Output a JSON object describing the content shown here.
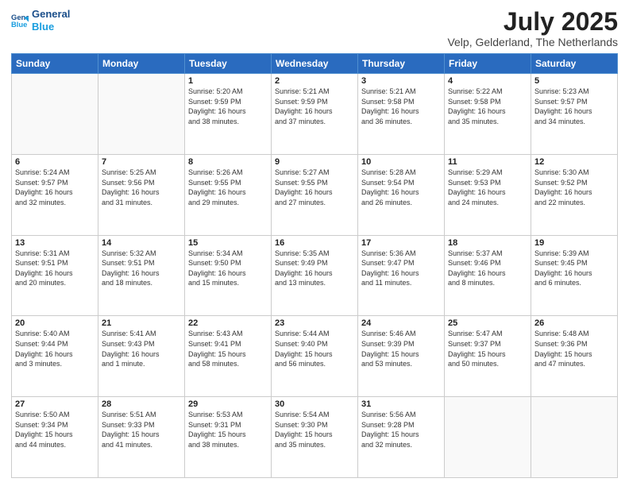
{
  "logo": {
    "line1": "General",
    "line2": "Blue"
  },
  "title": "July 2025",
  "subtitle": "Velp, Gelderland, The Netherlands",
  "header_days": [
    "Sunday",
    "Monday",
    "Tuesday",
    "Wednesday",
    "Thursday",
    "Friday",
    "Saturday"
  ],
  "weeks": [
    [
      {
        "day": "",
        "info": ""
      },
      {
        "day": "",
        "info": ""
      },
      {
        "day": "1",
        "info": "Sunrise: 5:20 AM\nSunset: 9:59 PM\nDaylight: 16 hours\nand 38 minutes."
      },
      {
        "day": "2",
        "info": "Sunrise: 5:21 AM\nSunset: 9:59 PM\nDaylight: 16 hours\nand 37 minutes."
      },
      {
        "day": "3",
        "info": "Sunrise: 5:21 AM\nSunset: 9:58 PM\nDaylight: 16 hours\nand 36 minutes."
      },
      {
        "day": "4",
        "info": "Sunrise: 5:22 AM\nSunset: 9:58 PM\nDaylight: 16 hours\nand 35 minutes."
      },
      {
        "day": "5",
        "info": "Sunrise: 5:23 AM\nSunset: 9:57 PM\nDaylight: 16 hours\nand 34 minutes."
      }
    ],
    [
      {
        "day": "6",
        "info": "Sunrise: 5:24 AM\nSunset: 9:57 PM\nDaylight: 16 hours\nand 32 minutes."
      },
      {
        "day": "7",
        "info": "Sunrise: 5:25 AM\nSunset: 9:56 PM\nDaylight: 16 hours\nand 31 minutes."
      },
      {
        "day": "8",
        "info": "Sunrise: 5:26 AM\nSunset: 9:55 PM\nDaylight: 16 hours\nand 29 minutes."
      },
      {
        "day": "9",
        "info": "Sunrise: 5:27 AM\nSunset: 9:55 PM\nDaylight: 16 hours\nand 27 minutes."
      },
      {
        "day": "10",
        "info": "Sunrise: 5:28 AM\nSunset: 9:54 PM\nDaylight: 16 hours\nand 26 minutes."
      },
      {
        "day": "11",
        "info": "Sunrise: 5:29 AM\nSunset: 9:53 PM\nDaylight: 16 hours\nand 24 minutes."
      },
      {
        "day": "12",
        "info": "Sunrise: 5:30 AM\nSunset: 9:52 PM\nDaylight: 16 hours\nand 22 minutes."
      }
    ],
    [
      {
        "day": "13",
        "info": "Sunrise: 5:31 AM\nSunset: 9:51 PM\nDaylight: 16 hours\nand 20 minutes."
      },
      {
        "day": "14",
        "info": "Sunrise: 5:32 AM\nSunset: 9:51 PM\nDaylight: 16 hours\nand 18 minutes."
      },
      {
        "day": "15",
        "info": "Sunrise: 5:34 AM\nSunset: 9:50 PM\nDaylight: 16 hours\nand 15 minutes."
      },
      {
        "day": "16",
        "info": "Sunrise: 5:35 AM\nSunset: 9:49 PM\nDaylight: 16 hours\nand 13 minutes."
      },
      {
        "day": "17",
        "info": "Sunrise: 5:36 AM\nSunset: 9:47 PM\nDaylight: 16 hours\nand 11 minutes."
      },
      {
        "day": "18",
        "info": "Sunrise: 5:37 AM\nSunset: 9:46 PM\nDaylight: 16 hours\nand 8 minutes."
      },
      {
        "day": "19",
        "info": "Sunrise: 5:39 AM\nSunset: 9:45 PM\nDaylight: 16 hours\nand 6 minutes."
      }
    ],
    [
      {
        "day": "20",
        "info": "Sunrise: 5:40 AM\nSunset: 9:44 PM\nDaylight: 16 hours\nand 3 minutes."
      },
      {
        "day": "21",
        "info": "Sunrise: 5:41 AM\nSunset: 9:43 PM\nDaylight: 16 hours\nand 1 minute."
      },
      {
        "day": "22",
        "info": "Sunrise: 5:43 AM\nSunset: 9:41 PM\nDaylight: 15 hours\nand 58 minutes."
      },
      {
        "day": "23",
        "info": "Sunrise: 5:44 AM\nSunset: 9:40 PM\nDaylight: 15 hours\nand 56 minutes."
      },
      {
        "day": "24",
        "info": "Sunrise: 5:46 AM\nSunset: 9:39 PM\nDaylight: 15 hours\nand 53 minutes."
      },
      {
        "day": "25",
        "info": "Sunrise: 5:47 AM\nSunset: 9:37 PM\nDaylight: 15 hours\nand 50 minutes."
      },
      {
        "day": "26",
        "info": "Sunrise: 5:48 AM\nSunset: 9:36 PM\nDaylight: 15 hours\nand 47 minutes."
      }
    ],
    [
      {
        "day": "27",
        "info": "Sunrise: 5:50 AM\nSunset: 9:34 PM\nDaylight: 15 hours\nand 44 minutes."
      },
      {
        "day": "28",
        "info": "Sunrise: 5:51 AM\nSunset: 9:33 PM\nDaylight: 15 hours\nand 41 minutes."
      },
      {
        "day": "29",
        "info": "Sunrise: 5:53 AM\nSunset: 9:31 PM\nDaylight: 15 hours\nand 38 minutes."
      },
      {
        "day": "30",
        "info": "Sunrise: 5:54 AM\nSunset: 9:30 PM\nDaylight: 15 hours\nand 35 minutes."
      },
      {
        "day": "31",
        "info": "Sunrise: 5:56 AM\nSunset: 9:28 PM\nDaylight: 15 hours\nand 32 minutes."
      },
      {
        "day": "",
        "info": ""
      },
      {
        "day": "",
        "info": ""
      }
    ]
  ]
}
